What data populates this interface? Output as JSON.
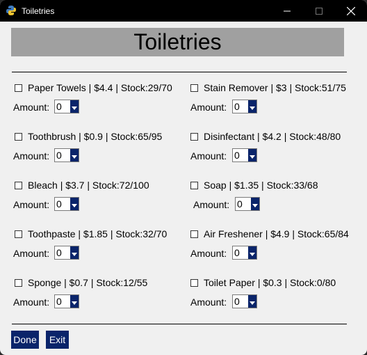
{
  "window": {
    "title": "Toiletries"
  },
  "header": {
    "title": "Toiletries"
  },
  "items": [
    {
      "label": "Paper Towels | $4.4 | Stock:29/70",
      "amount_label": "Amount:",
      "amount": "0"
    },
    {
      "label": "Stain Remover | $3 | Stock:51/75",
      "amount_label": "Amount:",
      "amount": "0"
    },
    {
      "label": "Toothbrush | $0.9 | Stock:65/95",
      "amount_label": "Amount:",
      "amount": "0"
    },
    {
      "label": "Disinfectant | $4.2 | Stock:48/80",
      "amount_label": "Amount:",
      "amount": "0"
    },
    {
      "label": "Bleach | $3.7 | Stock:72/100",
      "amount_label": "Amount:",
      "amount": "0"
    },
    {
      "label": "Soap | $1.35 | Stock:33/68",
      "amount_label": "Amount:",
      "amount": "0"
    },
    {
      "label": "Toothpaste | $1.85 | Stock:32/70",
      "amount_label": "Amount:",
      "amount": "0"
    },
    {
      "label": "Air Freshener | $4.9 | Stock:65/84",
      "amount_label": "Amount:",
      "amount": "0"
    },
    {
      "label": "Sponge | $0.7 | Stock:12/55",
      "amount_label": "Amount:",
      "amount": "0"
    },
    {
      "label": "Toilet Paper | $0.3 | Stock:0/80",
      "amount_label": "Amount:",
      "amount": "0"
    }
  ],
  "buttons": {
    "done": "Done",
    "exit": "Exit"
  },
  "colors": {
    "accent": "#0a246a",
    "banner": "#a0a0a0",
    "titlebar": "#000000"
  },
  "icons": {
    "app": "python-icon",
    "minimize": "minimize-icon",
    "maximize": "maximize-icon",
    "close": "close-icon"
  }
}
